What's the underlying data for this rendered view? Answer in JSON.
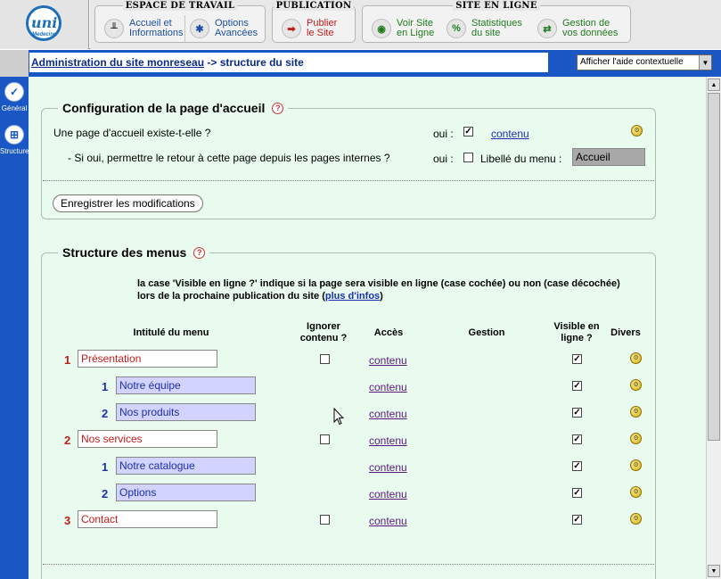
{
  "logo": {
    "text": "uni",
    "subtext": "Medecine"
  },
  "toolbar": {
    "workspace": {
      "title": "ESPACE DE TRAVAIL",
      "accueil_label": "Accueil et\nInformations",
      "options_label": "Options\nAvancées"
    },
    "publication": {
      "title": "PUBLICATION",
      "publier_label": "Publier\nle Site"
    },
    "site_en_ligne": {
      "title": "SITE EN LIGNE",
      "voir_label": "Voir Site\nen Ligne",
      "stats_label": "Statistiques\ndu site",
      "gestion_label": "Gestion de\nvos données"
    }
  },
  "sidebar": {
    "items": [
      {
        "label": "Général",
        "icon": "check-icon"
      },
      {
        "label": "Structure",
        "icon": "structure-icon"
      }
    ]
  },
  "header": {
    "breadcrumb_link": "Administration du site monreseau",
    "breadcrumb_current": "-> structure du site",
    "help_select_value": "Afficher l'aide contextuelle"
  },
  "config": {
    "title": "Configuration de la page d'accueil",
    "question_exists": "Une page d'accueil existe-t-elle ?",
    "oui_label_1": "oui :",
    "contenu_link": "contenu",
    "question_return": "- Si oui, permettre le retour à cette page depuis les pages internes ?",
    "oui_label_2": "oui :",
    "libelle_label": "Libellé du menu :",
    "libelle_value": "Accueil",
    "save_button": "Enregistrer les modifications"
  },
  "menus": {
    "title": "Structure des menus",
    "info_line1": "la case 'Visible en ligne ?' indique si la page sera visible en ligne (case cochée) ou non (case décochée)",
    "info_line2_prefix": "lors de la prochaine publication du site (",
    "info_link": "plus d'infos",
    "info_line2_suffix": ")",
    "columns": {
      "intitule": "Intitulé du menu",
      "ignorer": "Ignorer\ncontenu ?",
      "acces": "Accès",
      "gestion": "Gestion",
      "visible": "Visible en\nligne ?",
      "divers": "Divers"
    },
    "rows": [
      {
        "num": "1",
        "label": "Présentation",
        "level": 0,
        "ignore": false,
        "visible": true,
        "acces": "contenu"
      },
      {
        "num": "1",
        "label": "Notre équipe",
        "level": 1,
        "visible": true,
        "acces": "contenu"
      },
      {
        "num": "2",
        "label": "Nos produits",
        "level": 1,
        "visible": true,
        "acces": "contenu"
      },
      {
        "num": "2",
        "label": "Nos services",
        "level": 0,
        "ignore": false,
        "visible": true,
        "acces": "contenu"
      },
      {
        "num": "1",
        "label": "Notre catalogue",
        "level": 1,
        "visible": true,
        "acces": "contenu"
      },
      {
        "num": "2",
        "label": "Options",
        "level": 1,
        "visible": true,
        "acces": "contenu"
      },
      {
        "num": "3",
        "label": "Contact",
        "level": 0,
        "ignore": false,
        "visible": true,
        "acces": "contenu"
      }
    ]
  },
  "colors": {
    "accent_blue": "#1a56c4",
    "content_bg": "#e8fbee",
    "menu_red": "#c41b1b",
    "submenu_bg": "#d3d3ff"
  }
}
